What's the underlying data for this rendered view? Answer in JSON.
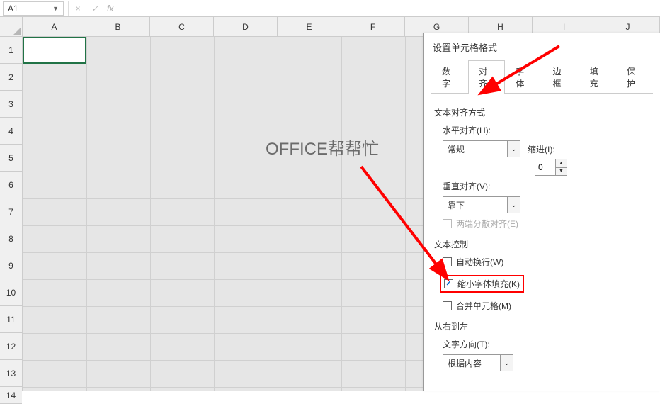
{
  "formula_bar": {
    "name_box": "A1",
    "cancel": "×",
    "confirm": "✓",
    "fx": "fx"
  },
  "columns": [
    "A",
    "B",
    "C",
    "D",
    "E",
    "F",
    "G",
    "H",
    "I",
    "J"
  ],
  "rows": [
    "1",
    "2",
    "3",
    "4",
    "5",
    "6",
    "7",
    "8",
    "9",
    "10",
    "11",
    "12",
    "13",
    "14"
  ],
  "watermark": "OFFICE帮帮忙",
  "dialog": {
    "title": "设置单元格格式",
    "tabs": [
      "数字",
      "对齐",
      "字体",
      "边框",
      "填充",
      "保护"
    ],
    "active_tab": "对齐",
    "sections": {
      "text_align": {
        "title": "文本对齐方式",
        "h_label": "水平对齐(H):",
        "h_value": "常规",
        "indent_label": "缩进(I):",
        "indent_value": "0",
        "v_label": "垂直对齐(V):",
        "v_value": "靠下",
        "justify_distributed": "两端分散对齐(E)"
      },
      "text_control": {
        "title": "文本控制",
        "wrap": "自动换行(W)",
        "shrink": "缩小字体填充(K)",
        "merge": "合并单元格(M)"
      },
      "rtl": {
        "title": "从右到左",
        "dir_label": "文字方向(T):",
        "dir_value": "根据内容"
      }
    }
  }
}
